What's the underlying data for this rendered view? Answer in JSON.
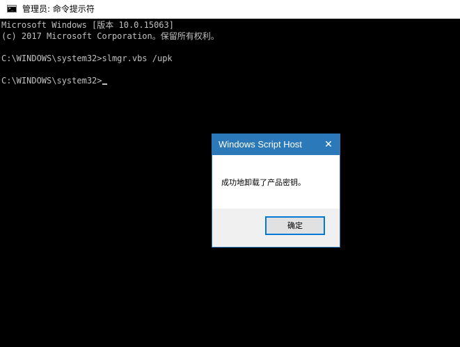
{
  "window": {
    "title": "管理员: 命令提示符",
    "icon": "console-icon"
  },
  "console": {
    "lines": [
      "Microsoft Windows [版本 10.0.15063]",
      "(c) 2017 Microsoft Corporation。保留所有权利。",
      "",
      "C:\\WINDOWS\\system32>slmgr.vbs /upk",
      "",
      "C:\\WINDOWS\\system32>"
    ]
  },
  "dialog": {
    "title": "Windows Script Host",
    "close_icon": "close-icon",
    "message": "成功地卸载了产品密钥。",
    "ok_label": "确定"
  },
  "colors": {
    "console_bg": "#000000",
    "console_text": "#c0c0c0",
    "dialog_accent": "#2b79b8"
  }
}
